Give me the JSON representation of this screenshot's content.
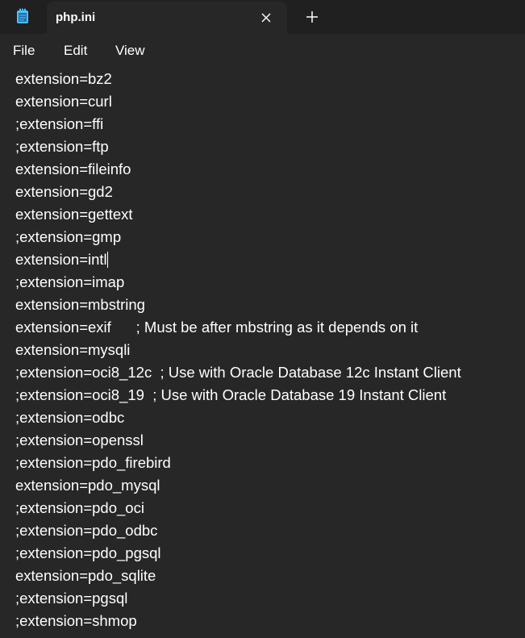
{
  "tab": {
    "title": "php.ini"
  },
  "menu": {
    "file": "File",
    "edit": "Edit",
    "view": "View"
  },
  "icons": {
    "app": "notepad-icon",
    "close": "close-icon",
    "new_tab": "plus-icon"
  },
  "colors": {
    "background": "#272727",
    "titlebar": "#202020",
    "text": "#ffffff",
    "accent": "#4cc2ff"
  },
  "editor": {
    "lines": [
      "extension=bz2",
      "extension=curl",
      ";extension=ffi",
      ";extension=ftp",
      "extension=fileinfo",
      "extension=gd2",
      "extension=gettext",
      ";extension=gmp",
      "extension=intl",
      ";extension=imap",
      "extension=mbstring",
      "extension=exif      ; Must be after mbstring as it depends on it",
      "extension=mysqli",
      ";extension=oci8_12c  ; Use with Oracle Database 12c Instant Client",
      ";extension=oci8_19  ; Use with Oracle Database 19 Instant Client",
      ";extension=odbc",
      ";extension=openssl",
      ";extension=pdo_firebird",
      "extension=pdo_mysql",
      ";extension=pdo_oci",
      ";extension=pdo_odbc",
      ";extension=pdo_pgsql",
      "extension=pdo_sqlite",
      ";extension=pgsql",
      ";extension=shmop"
    ],
    "caret_line": 8
  }
}
